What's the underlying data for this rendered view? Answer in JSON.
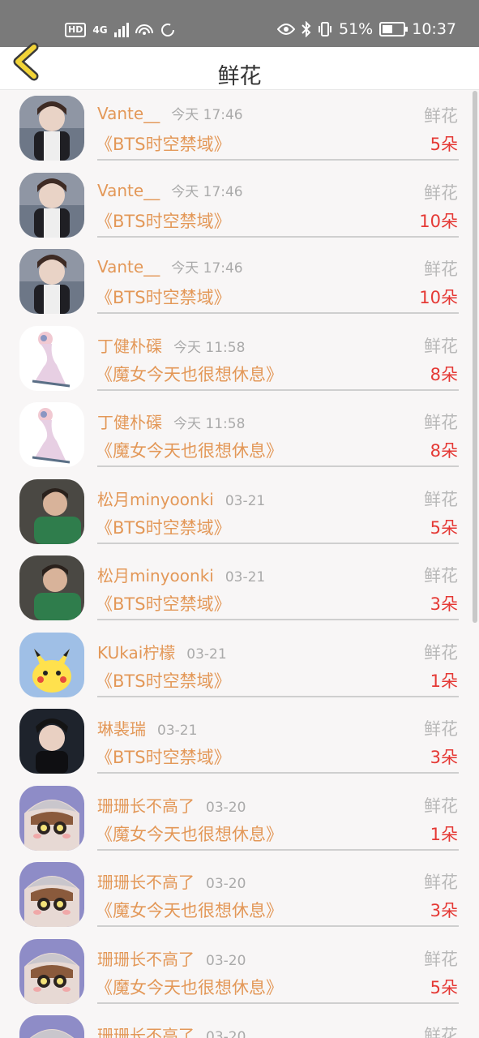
{
  "status_bar": {
    "left_labels": [
      "HD",
      "4G"
    ],
    "battery": "51%",
    "time": "10:37"
  },
  "header": {
    "title": "鲜花"
  },
  "rows": [
    {
      "name": "Vante__",
      "time": "今天 17:46",
      "label": "鲜花",
      "book": "《BTS时空禁域》",
      "count": "5朵",
      "avatar": "avatar-a"
    },
    {
      "name": "Vante__",
      "time": "今天 17:46",
      "label": "鲜花",
      "book": "《BTS时空禁域》",
      "count": "10朵",
      "avatar": "avatar-a"
    },
    {
      "name": "Vante__",
      "time": "今天 17:46",
      "label": "鲜花",
      "book": "《BTS时空禁域》",
      "count": "10朵",
      "avatar": "avatar-a"
    },
    {
      "name": "丁健朴磲",
      "time": "今天 11:58",
      "label": "鲜花",
      "book": "《魔女今天也很想休息》",
      "count": "8朵",
      "avatar": "avatar-b"
    },
    {
      "name": "丁健朴磲",
      "time": "今天 11:58",
      "label": "鲜花",
      "book": "《魔女今天也很想休息》",
      "count": "8朵",
      "avatar": "avatar-b"
    },
    {
      "name": "松月minyoonki",
      "time": "03-21",
      "label": "鲜花",
      "book": "《BTS时空禁域》",
      "count": "5朵",
      "avatar": "avatar-c"
    },
    {
      "name": "松月minyoonki",
      "time": "03-21",
      "label": "鲜花",
      "book": "《BTS时空禁域》",
      "count": "3朵",
      "avatar": "avatar-c"
    },
    {
      "name": "KUkai柠檬",
      "time": "03-21",
      "label": "鲜花",
      "book": "《BTS时空禁域》",
      "count": "1朵",
      "avatar": "avatar-d"
    },
    {
      "name": "琳裴瑞",
      "time": "03-21",
      "label": "鲜花",
      "book": "《BTS时空禁域》",
      "count": "3朵",
      "avatar": "avatar-e"
    },
    {
      "name": "珊珊长不高了",
      "time": "03-20",
      "label": "鲜花",
      "book": "《魔女今天也很想休息》",
      "count": "1朵",
      "avatar": "avatar-f"
    },
    {
      "name": "珊珊长不高了",
      "time": "03-20",
      "label": "鲜花",
      "book": "《魔女今天也很想休息》",
      "count": "3朵",
      "avatar": "avatar-f"
    },
    {
      "name": "珊珊长不高了",
      "time": "03-20",
      "label": "鲜花",
      "book": "《魔女今天也很想休息》",
      "count": "5朵",
      "avatar": "avatar-f"
    },
    {
      "name": "珊珊长不高了",
      "time": "03-20",
      "label": "鲜花",
      "book": "",
      "count": "",
      "avatar": "avatar-f"
    }
  ],
  "colors": {
    "name": "#e39858",
    "count": "#e53935",
    "label": "#b9b9b9",
    "back_arrow": "#f2d438"
  }
}
